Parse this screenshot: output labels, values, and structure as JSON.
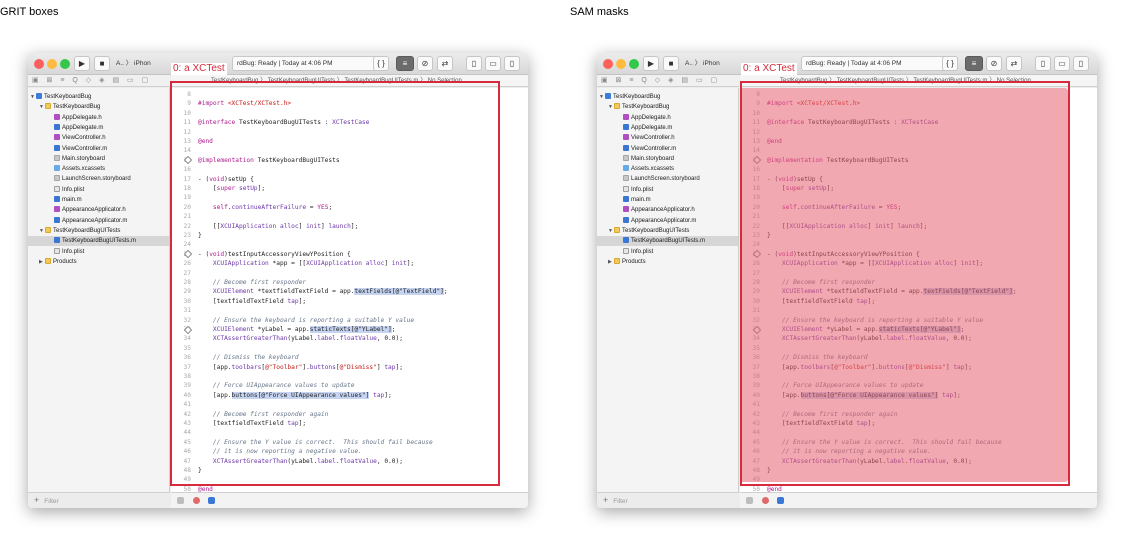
{
  "panels": [
    {
      "title": "GRIT boxes",
      "kind": "box"
    },
    {
      "title": "SAM masks",
      "kind": "mask"
    }
  ],
  "annotation": {
    "label": "0: a XCTest",
    "color": "#d52b3c",
    "mask_color": "#e86070"
  },
  "window": {
    "scheme_label": "A..  〉 iPhon",
    "status_text": "rdBug: Ready | Today at 4:06 PM",
    "jumpbar_text": "TestKeyboardBug 〉 TestKeyboardBugUITests 〉 TestKeyboardBugUITests.m 〉 No Selection",
    "filter_placeholder": "Filter",
    "nav_tabs": "▣ ⊠ ≡ Q ◇ ◈ ▤ ▭ ▢"
  },
  "tree": [
    {
      "label": "TestKeyboardBug",
      "depth": 0,
      "icon": "proj",
      "open": true
    },
    {
      "label": "TestKeyboardBug",
      "depth": 1,
      "icon": "folder",
      "open": true
    },
    {
      "label": "AppDelegate.h",
      "depth": 2,
      "icon": "h"
    },
    {
      "label": "AppDelegate.m",
      "depth": 2,
      "icon": "m"
    },
    {
      "label": "ViewController.h",
      "depth": 2,
      "icon": "h"
    },
    {
      "label": "ViewController.m",
      "depth": 2,
      "icon": "m"
    },
    {
      "label": "Main.storyboard",
      "depth": 2,
      "icon": "sb"
    },
    {
      "label": "Assets.xcassets",
      "depth": 2,
      "icon": "assets"
    },
    {
      "label": "LaunchScreen.storyboard",
      "depth": 2,
      "icon": "sb"
    },
    {
      "label": "Info.plist",
      "depth": 2,
      "icon": "plist"
    },
    {
      "label": "main.m",
      "depth": 2,
      "icon": "m"
    },
    {
      "label": "AppearanceApplicator.h",
      "depth": 2,
      "icon": "h"
    },
    {
      "label": "AppearanceApplicator.m",
      "depth": 2,
      "icon": "m"
    },
    {
      "label": "TestKeyboardBugUITests",
      "depth": 1,
      "icon": "folder",
      "open": true
    },
    {
      "label": "TestKeyboardBugUITests.m",
      "depth": 2,
      "icon": "m",
      "selected": true
    },
    {
      "label": "Info.plist",
      "depth": 2,
      "icon": "plist"
    },
    {
      "label": "Products",
      "depth": 1,
      "icon": "folder",
      "open": false
    }
  ],
  "code": [
    {
      "n": "8",
      "t": []
    },
    {
      "n": "9",
      "t": [
        [
          "#import ",
          "kw"
        ],
        [
          "<XCTest/XCTest.h>",
          "st"
        ]
      ]
    },
    {
      "n": "10",
      "t": []
    },
    {
      "n": "11",
      "t": [
        [
          "@interface",
          "kw"
        ],
        [
          " TestKeyboardBugUITests : ",
          ""
        ],
        [
          "XCTestCase",
          "ty"
        ]
      ]
    },
    {
      "n": "12",
      "t": []
    },
    {
      "n": "13",
      "t": [
        [
          "@end",
          "kw"
        ]
      ]
    },
    {
      "n": "14",
      "t": []
    },
    {
      "n": "15",
      "t": [
        [
          "@implementation",
          "kw"
        ],
        [
          " TestKeyboardBugUITests",
          ""
        ]
      ]
    },
    {
      "n": "16",
      "t": []
    },
    {
      "n": "17",
      "t": [
        [
          "- (",
          ""
        ],
        [
          "void",
          "kw"
        ],
        [
          ")setUp {",
          ""
        ]
      ]
    },
    {
      "n": "18",
      "t": [
        [
          "    [",
          ""
        ],
        [
          "super",
          "kw"
        ],
        [
          " ",
          ""
        ],
        [
          "setUp",
          "ty"
        ],
        [
          "];",
          ""
        ]
      ]
    },
    {
      "n": "19",
      "t": []
    },
    {
      "n": "20",
      "t": [
        [
          "    ",
          ""
        ],
        [
          "self",
          "kw"
        ],
        [
          ".",
          ""
        ],
        [
          "continueAfterFailure",
          "ty"
        ],
        [
          " = ",
          ""
        ],
        [
          "YES",
          "kw"
        ],
        [
          ";",
          ""
        ]
      ]
    },
    {
      "n": "21",
      "t": []
    },
    {
      "n": "22",
      "t": [
        [
          "    [[",
          ""
        ],
        [
          "XCUIApplication",
          "ty"
        ],
        [
          " ",
          ""
        ],
        [
          "alloc",
          "ty"
        ],
        [
          "] ",
          ""
        ],
        [
          "init",
          "ty"
        ],
        [
          "] ",
          ""
        ],
        [
          "launch",
          "ty"
        ],
        [
          "];",
          ""
        ]
      ]
    },
    {
      "n": "23",
      "t": [
        [
          "}",
          ""
        ]
      ]
    },
    {
      "n": "24",
      "t": []
    },
    {
      "n": "25",
      "t": [
        [
          "- (",
          ""
        ],
        [
          "void",
          "kw"
        ],
        [
          ")testInputAccessoryViewYPosition {",
          ""
        ]
      ]
    },
    {
      "n": "26",
      "t": [
        [
          "    ",
          ""
        ],
        [
          "XCUIApplication",
          "ty"
        ],
        [
          " *app = [[",
          ""
        ],
        [
          "XCUIApplication",
          "ty"
        ],
        [
          " ",
          ""
        ],
        [
          "alloc",
          "ty"
        ],
        [
          "] ",
          ""
        ],
        [
          "init",
          "ty"
        ],
        [
          "];",
          ""
        ]
      ]
    },
    {
      "n": "27",
      "t": []
    },
    {
      "n": "28",
      "t": [
        [
          "    // Become first responder",
          "cm"
        ]
      ]
    },
    {
      "n": "29",
      "t": [
        [
          "    ",
          ""
        ],
        [
          "XCUIElement",
          "ty"
        ],
        [
          " *textfieldTextField = app.",
          ""
        ],
        [
          "textFields[@\"TextField\"]",
          "hl"
        ],
        [
          ";",
          ""
        ]
      ]
    },
    {
      "n": "30",
      "t": [
        [
          "    [textfieldTextField ",
          ""
        ],
        [
          "tap",
          "ty"
        ],
        [
          "];",
          ""
        ]
      ]
    },
    {
      "n": "31",
      "t": []
    },
    {
      "n": "32",
      "t": [
        [
          "    // Ensure the keyboard is reporting a suitable Y value",
          "cm"
        ]
      ]
    },
    {
      "n": "33",
      "t": [
        [
          "    ",
          ""
        ],
        [
          "XCUIElement",
          "ty"
        ],
        [
          " *yLabel = app.",
          ""
        ],
        [
          "staticTexts[@\"YLabel\"]",
          "hl"
        ],
        [
          ";",
          ""
        ]
      ]
    },
    {
      "n": "34",
      "t": [
        [
          "    ",
          ""
        ],
        [
          "XCTAssertGreaterThan",
          "ty"
        ],
        [
          "(yLabel.",
          ""
        ],
        [
          "label",
          "ty"
        ],
        [
          ".",
          ""
        ],
        [
          "floatValue",
          "ty"
        ],
        [
          ", 0.0);",
          ""
        ]
      ]
    },
    {
      "n": "35",
      "t": []
    },
    {
      "n": "36",
      "t": [
        [
          "    // Dismiss the keyboard",
          "cm"
        ]
      ]
    },
    {
      "n": "37",
      "t": [
        [
          "    [app.",
          ""
        ],
        [
          "toolbars",
          "ty"
        ],
        [
          "[",
          ""
        ],
        [
          "@\"Toolbar\"",
          "st"
        ],
        [
          "].",
          ""
        ],
        [
          "buttons",
          "ty"
        ],
        [
          "[",
          ""
        ],
        [
          "@\"Dismiss\"",
          "st"
        ],
        [
          "] ",
          ""
        ],
        [
          "tap",
          "ty"
        ],
        [
          "];",
          ""
        ]
      ]
    },
    {
      "n": "38",
      "t": []
    },
    {
      "n": "39",
      "t": [
        [
          "    // Force UIAppearance values to update",
          "cm"
        ]
      ]
    },
    {
      "n": "40",
      "t": [
        [
          "    [app.",
          ""
        ],
        [
          "buttons[@\"Force UIAppearance values\"]",
          "hl"
        ],
        [
          " ",
          ""
        ],
        [
          "tap",
          "ty"
        ],
        [
          "];",
          ""
        ]
      ]
    },
    {
      "n": "41",
      "t": []
    },
    {
      "n": "42",
      "t": [
        [
          "    // Become first responder again",
          "cm"
        ]
      ]
    },
    {
      "n": "43",
      "t": [
        [
          "    [textfieldTextField ",
          ""
        ],
        [
          "tap",
          "ty"
        ],
        [
          "];",
          ""
        ]
      ]
    },
    {
      "n": "44",
      "t": []
    },
    {
      "n": "45",
      "t": [
        [
          "    // Ensure the Y value is correct.  This should fail because",
          "cm"
        ]
      ]
    },
    {
      "n": "46",
      "t": [
        [
          "    // it is now reporting a negative value.",
          "cm"
        ]
      ]
    },
    {
      "n": "47",
      "t": [
        [
          "    ",
          ""
        ],
        [
          "XCTAssertGreaterThan",
          "ty"
        ],
        [
          "(yLabel.",
          ""
        ],
        [
          "label",
          "ty"
        ],
        [
          ".",
          ""
        ],
        [
          "floatValue",
          "ty"
        ],
        [
          ", 0.0);",
          ""
        ]
      ]
    },
    {
      "n": "48",
      "t": [
        [
          "}",
          ""
        ]
      ]
    },
    {
      "n": "49",
      "t": []
    },
    {
      "n": "50",
      "t": [
        [
          "@end",
          "kw"
        ]
      ]
    }
  ]
}
